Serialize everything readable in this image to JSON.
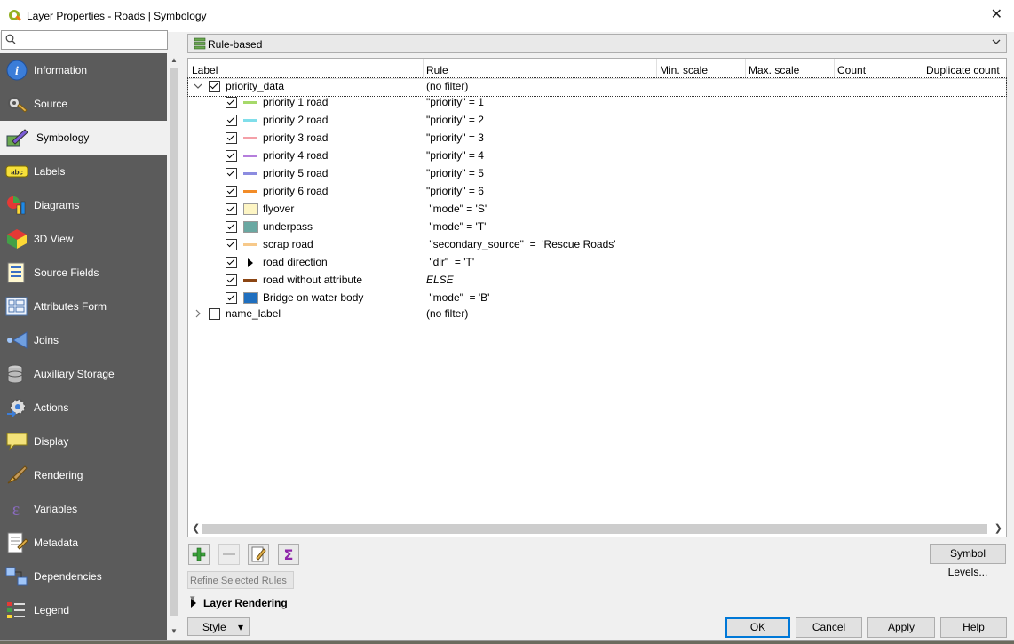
{
  "window": {
    "title": "Layer Properties - Roads | Symbology",
    "close_glyph": "✕"
  },
  "search": {
    "placeholder": ""
  },
  "sidebar": {
    "items": [
      {
        "label": "Information",
        "icon": "info-icon"
      },
      {
        "label": "Source",
        "icon": "source-icon"
      },
      {
        "label": "Symbology",
        "icon": "symbology-icon",
        "active": true
      },
      {
        "label": "Labels",
        "icon": "labels-icon"
      },
      {
        "label": "Diagrams",
        "icon": "diagrams-icon"
      },
      {
        "label": "3D View",
        "icon": "3d-view-icon"
      },
      {
        "label": "Source Fields",
        "icon": "source-fields-icon"
      },
      {
        "label": "Attributes Form",
        "icon": "attributes-form-icon"
      },
      {
        "label": "Joins",
        "icon": "joins-icon"
      },
      {
        "label": "Auxiliary Storage",
        "icon": "auxiliary-storage-icon"
      },
      {
        "label": "Actions",
        "icon": "actions-icon"
      },
      {
        "label": "Display",
        "icon": "display-icon"
      },
      {
        "label": "Rendering",
        "icon": "rendering-icon"
      },
      {
        "label": "Variables",
        "icon": "variables-icon"
      },
      {
        "label": "Metadata",
        "icon": "metadata-icon"
      },
      {
        "label": "Dependencies",
        "icon": "dependencies-icon"
      },
      {
        "label": "Legend",
        "icon": "legend-icon"
      }
    ]
  },
  "renderer": {
    "selected": "Rule-based"
  },
  "tree": {
    "columns": [
      "Label",
      "Rule",
      "Min. scale",
      "Max. scale",
      "Count",
      "Duplicate count"
    ],
    "groups": [
      {
        "label": "priority_data",
        "rule": "(no filter)",
        "checked": true,
        "expanded": true,
        "children": [
          {
            "label": "priority 1 road",
            "rule": "\"priority\" = 1",
            "checked": true,
            "symbol": "line",
            "color": "#a6d96a"
          },
          {
            "label": "priority 2 road",
            "rule": "\"priority\" = 2",
            "checked": true,
            "symbol": "line",
            "color": "#80deea"
          },
          {
            "label": "priority 3 road",
            "rule": "\"priority\" = 3",
            "checked": true,
            "symbol": "line",
            "color": "#f4a0a8"
          },
          {
            "label": "priority 4 road",
            "rule": "\"priority\" = 4",
            "checked": true,
            "symbol": "line",
            "color": "#b57edc"
          },
          {
            "label": "priority 5 road",
            "rule": "\"priority\" = 5",
            "checked": true,
            "symbol": "line",
            "color": "#8c8ce0"
          },
          {
            "label": "priority 6 road",
            "rule": "\"priority\" = 6",
            "checked": true,
            "symbol": "line",
            "color": "#f28c28"
          },
          {
            "label": "flyover",
            "rule": " \"mode\" = 'S'",
            "checked": true,
            "symbol": "fill",
            "color": "#fdf5c4"
          },
          {
            "label": "underpass",
            "rule": " \"mode\" = 'T'",
            "checked": true,
            "symbol": "fill",
            "color": "#6aa8a2"
          },
          {
            "label": "scrap road",
            "rule": " \"secondary_source\"  =  'Rescue Roads'",
            "checked": true,
            "symbol": "line",
            "color": "#f7c98a"
          },
          {
            "label": "road direction",
            "rule": " \"dir\"  = 'T'",
            "checked": true,
            "symbol": "arrow",
            "color": "#000000"
          },
          {
            "label": "road without attribute",
            "rule": "ELSE",
            "checked": true,
            "symbol": "line",
            "color": "#8b4513"
          },
          {
            "label": "Bridge on water body",
            "rule": " \"mode\"  = 'B'",
            "checked": true,
            "symbol": "fill",
            "color": "#1f6fbf"
          }
        ]
      },
      {
        "label": "name_label",
        "rule": "(no filter)",
        "checked": false,
        "expanded": false,
        "children": []
      }
    ]
  },
  "toolbar": {
    "symbol_levels_label": "Symbol Levels...",
    "refine_label": "Refine Selected Rules"
  },
  "layer_rendering": {
    "label": "Layer Rendering"
  },
  "footer": {
    "style_label": "Style",
    "ok_label": "OK",
    "cancel_label": "Cancel",
    "apply_label": "Apply",
    "help_label": "Help"
  }
}
